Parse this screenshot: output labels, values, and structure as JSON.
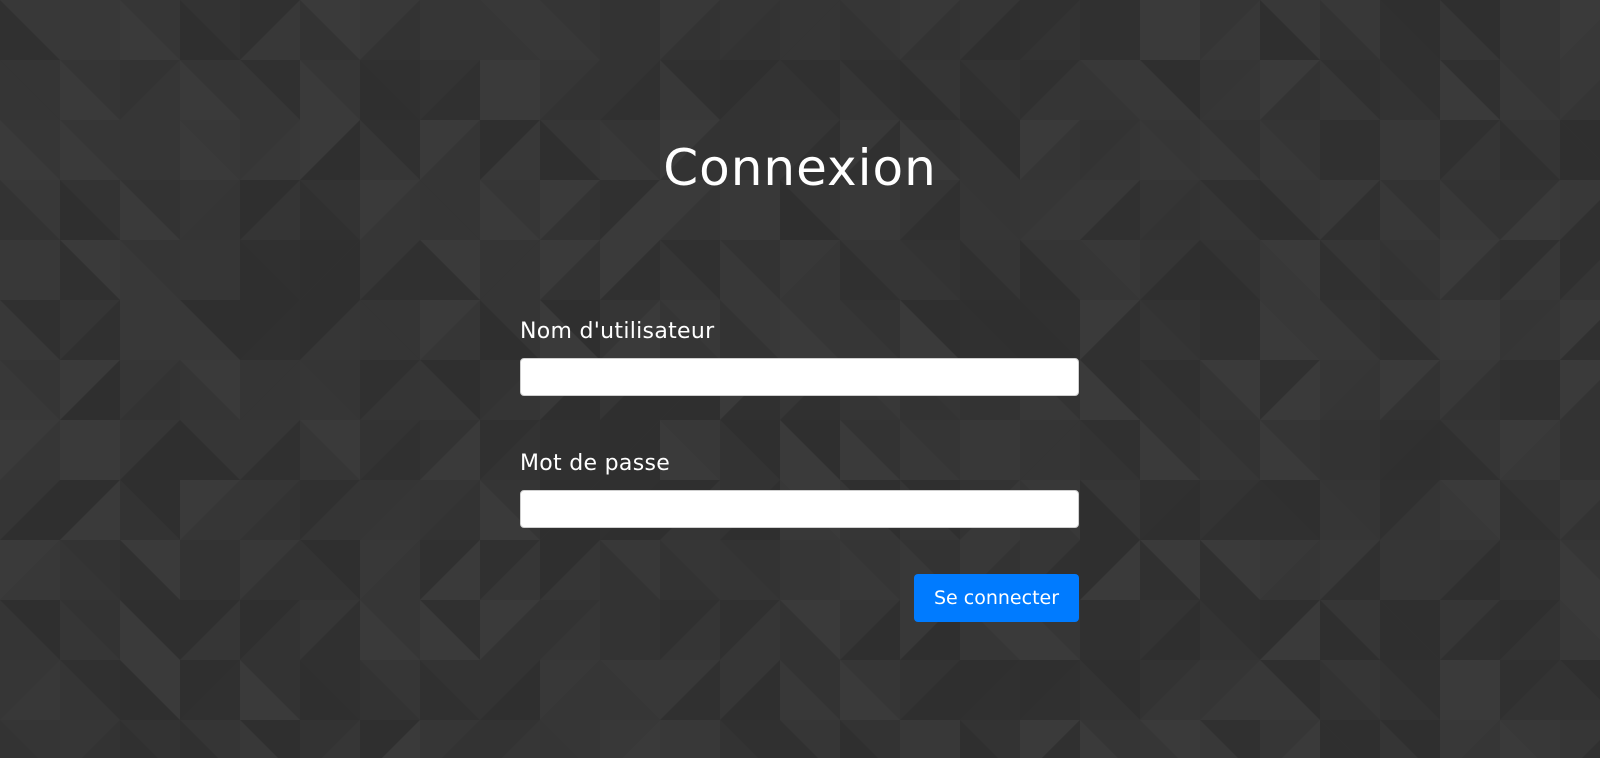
{
  "colors": {
    "background": "#363636",
    "accent": "#007bff",
    "field_background": "#ffffff",
    "text": "#ffffff"
  },
  "login": {
    "title": "Connexion",
    "username_label": "Nom d'utilisateur",
    "username_value": "",
    "password_label": "Mot de passe",
    "password_value": "",
    "submit_label": "Se connecter"
  }
}
